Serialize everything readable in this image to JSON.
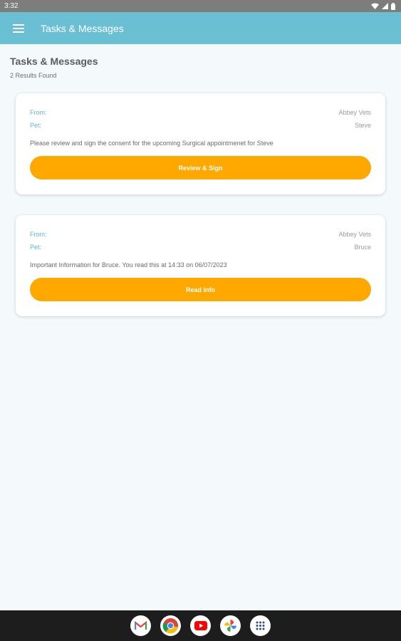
{
  "status_bar": {
    "time": "3:32"
  },
  "app_bar": {
    "title": "Tasks & Messages"
  },
  "page": {
    "title": "Tasks & Messages",
    "results": "2 Results Found"
  },
  "cards": [
    {
      "from_label": "From:",
      "from_value": "Abbey Vets",
      "pet_label": "Pet:",
      "pet_value": "Steve",
      "message": "Please review and sign the consent for the upcoming Surgical appointmenet for Steve",
      "button": "Review & Sign"
    },
    {
      "from_label": "From:",
      "from_value": "Abbey Vets",
      "pet_label": "Pet:",
      "pet_value": "Bruce",
      "message": "Important Information for Bruce. You read this at 14:33 on 06/07/2023",
      "button": "Read Info"
    }
  ],
  "nav_apps": [
    "gmail-icon",
    "chrome-icon",
    "youtube-icon",
    "photos-icon",
    "app-drawer-icon"
  ],
  "colors": {
    "app_bar": "#6bbfd3",
    "accent": "#ffa800",
    "label": "#5fb7cc"
  }
}
